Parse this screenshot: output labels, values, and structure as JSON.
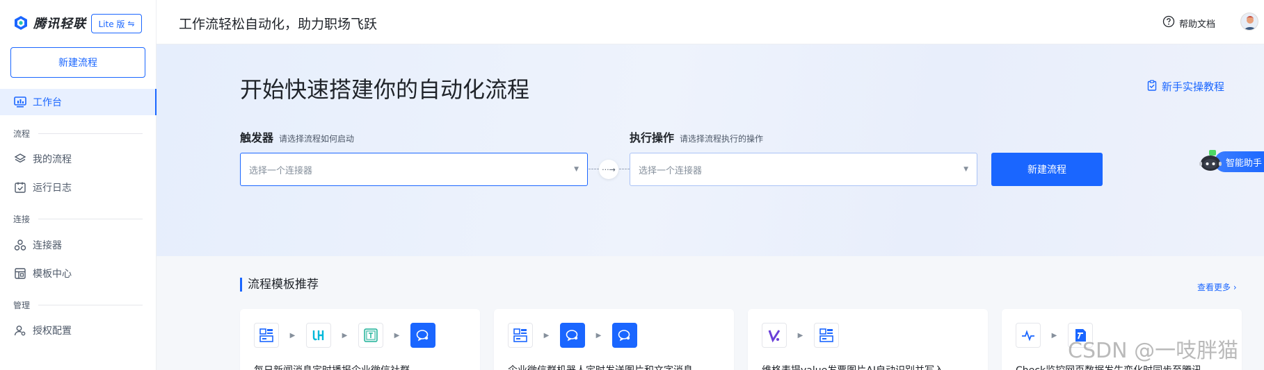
{
  "brand": {
    "name": "腾讯轻联",
    "lite_label": "Lite 版"
  },
  "sidebar": {
    "new_flow": "新建流程",
    "items": [
      {
        "label": "工作台",
        "icon": "dashboard-icon"
      },
      {
        "section": "流程"
      },
      {
        "label": "我的流程",
        "icon": "layers-icon"
      },
      {
        "label": "运行日志",
        "icon": "calendar-check-icon"
      },
      {
        "section": "连接"
      },
      {
        "label": "连接器",
        "icon": "connector-icon"
      },
      {
        "label": "模板中心",
        "icon": "template-icon"
      },
      {
        "section": "管理"
      },
      {
        "label": "授权配置",
        "icon": "user-settings-icon"
      }
    ]
  },
  "topbar": {
    "slogan": "工作流轻松自动化，助力职场飞跃",
    "help": "帮助文档"
  },
  "hero": {
    "title": "开始快速搭建你的自动化流程",
    "tutorial": "新手实操教程",
    "trigger": {
      "label": "触发器",
      "hint": "请选择流程如何启动",
      "placeholder": "选择一个连接器"
    },
    "action": {
      "label": "执行操作",
      "hint": "请选择流程执行的操作",
      "placeholder": "选择一个连接器"
    },
    "new_flow": "新建流程",
    "assistant": "智能助手"
  },
  "templates": {
    "title": "流程模板推荐",
    "more": "查看更多",
    "cards": [
      {
        "desc": "每日新闻消息定时播报企业微信社群"
      },
      {
        "desc": "企业微信群机器人定时发送图片和文字消息"
      },
      {
        "desc": "维格表提value发票图片AI自动识别并写入"
      },
      {
        "desc": "Check监控网页数据发生变化时同步至腾讯"
      }
    ]
  },
  "watermark": "CSDN @一吱胖猫",
  "colors": {
    "accent": "#1a66ff"
  }
}
